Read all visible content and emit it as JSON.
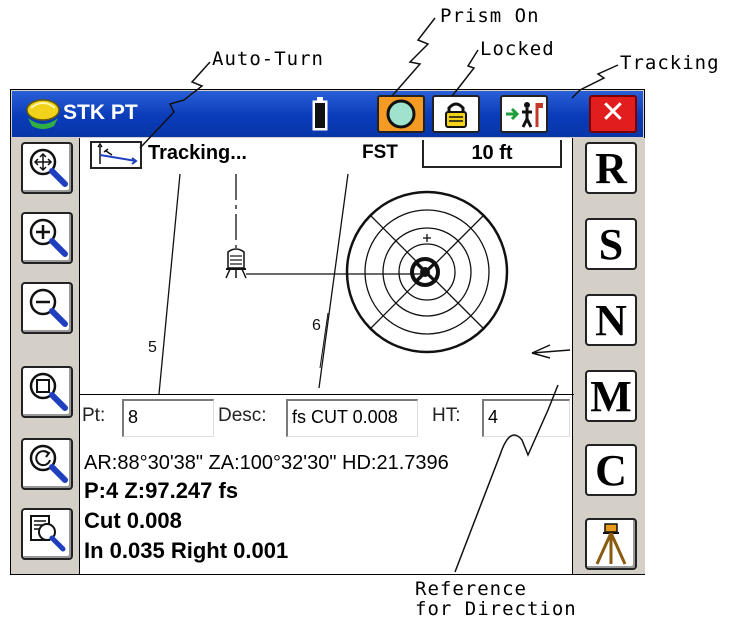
{
  "annotations": {
    "prism_on": "Prism On",
    "locked": "Locked",
    "auto_turn": "Auto-Turn",
    "tracking": "Tracking",
    "reference_line1": "Reference",
    "reference_line2": "for Direction"
  },
  "titlebar": {
    "title": "STK PT",
    "close_label": "✕",
    "colors": {
      "bar": "#0a3bb8",
      "prism": "#f59a22",
      "close": "#e21d1d"
    }
  },
  "toolbar": {
    "status": "Tracking...",
    "mode": "FST",
    "scale": "10 ft"
  },
  "plot": {
    "line_labels": [
      "5",
      "6"
    ]
  },
  "fields": {
    "pt_label": "Pt:",
    "pt_value": "8",
    "desc_label": "Desc:",
    "desc_value": "fs CUT 0.008",
    "ht_label": "HT:",
    "ht_value": "4"
  },
  "info": {
    "angles": "AR:88°30'38\"  ZA:100°32'30\" HD:21.7396",
    "point": "P:4 Z:97.247 fs",
    "cut": "Cut 0.008",
    "offset": "In 0.035 Right 0.001"
  },
  "right_buttons": [
    "R",
    "S",
    "N",
    "M",
    "C"
  ],
  "icons": {
    "left": [
      "zoom-extents-icon",
      "zoom-in-icon",
      "zoom-out-icon",
      "zoom-window-icon",
      "zoom-previous-icon",
      "zoom-object-icon"
    ],
    "right_last": "tripod-icon"
  }
}
